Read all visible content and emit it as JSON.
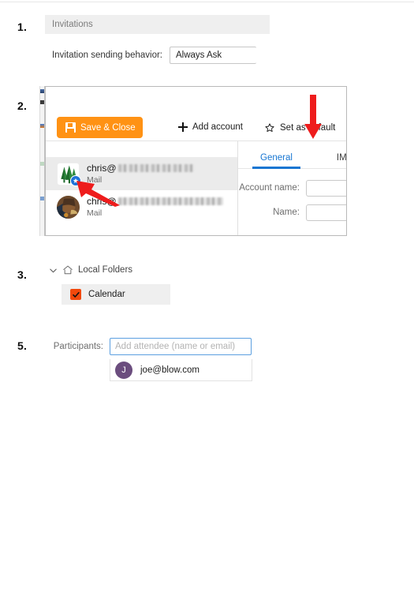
{
  "steps": {
    "one": "1.",
    "two": "2.",
    "three": "3.",
    "five": "5."
  },
  "section1": {
    "group_header": "Invitations",
    "field_label": "Invitation sending behavior:",
    "field_value": "Always Ask"
  },
  "section2": {
    "toolbar": {
      "save_label": "Save & Close",
      "save_icon": "floppy-disk-icon",
      "add_account_label": "Add account",
      "add_account_icon": "plus-icon",
      "set_default_label": "Set as default",
      "set_default_icon": "star-outline-icon"
    },
    "accounts": [
      {
        "email_prefix": "chris@",
        "email_redacted": true,
        "redact_width": 96,
        "type": "Mail",
        "avatar": "pine-trees-avatar",
        "default_badge": true,
        "selected": true
      },
      {
        "email_prefix": "chris@",
        "email_redacted": true,
        "redact_width": 133,
        "type": "Mail",
        "avatar": "photo-avatar",
        "default_badge": false,
        "selected": false
      }
    ],
    "detail": {
      "tabs": [
        {
          "label": "General",
          "active": true
        },
        {
          "label": "IMAP",
          "active": false
        }
      ],
      "fields": [
        {
          "label": "Account name:",
          "value": ""
        },
        {
          "label": "Name:",
          "value": ""
        }
      ]
    },
    "annotations": [
      {
        "name": "arrow-down-set-default",
        "color": "#ee1c1c"
      },
      {
        "name": "arrow-diagonal-default-badge",
        "color": "#ee1c1c"
      }
    ]
  },
  "section3": {
    "header_label": "Local Folders",
    "header_icon": "home-icon",
    "expander_icon": "chevron-down-icon",
    "expanded": true,
    "items": [
      {
        "label": "Calendar",
        "checked": true,
        "checkbox_color": "#f2490c"
      }
    ]
  },
  "section5": {
    "field_label": "Participants:",
    "input_placeholder": "Add attendee (name or email)",
    "input_value": "",
    "suggestions": [
      {
        "initial": "J",
        "email": "joe@blow.com",
        "avatar_color": "#6b4d7e"
      }
    ]
  },
  "colors": {
    "accent_orange": "#ff9214",
    "tab_blue": "#1776d2",
    "badge_blue": "#1f72d8",
    "checkbox_orange": "#f2490c",
    "annotation_red": "#ee1c1c"
  }
}
